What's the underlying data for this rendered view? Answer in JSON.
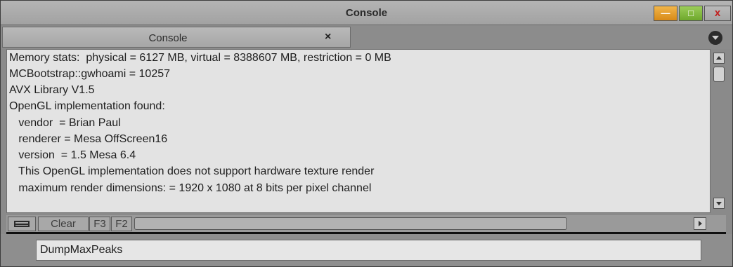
{
  "window": {
    "title": "Console",
    "minimize_glyph": "—",
    "maximize_glyph": "□",
    "close_glyph": "x"
  },
  "tab": {
    "label": "Console",
    "close_glyph": "×"
  },
  "output": {
    "lines": [
      "Memory stats:  physical = 6127 MB, virtual = 8388607 MB, restriction = 0 MB",
      "MCBootstrap::gwhoami = 10257",
      "AVX Library V1.5",
      "OpenGL implementation found:",
      "   vendor  = Brian Paul",
      "   renderer = Mesa OffScreen16",
      "   version  = 1.5 Mesa 6.4",
      "   This OpenGL implementation does not support hardware texture render",
      "   maximum render dimensions: = 1920 x 1080 at 8 bits per pixel channel"
    ]
  },
  "toolbar": {
    "clear_label": "Clear",
    "f3_label": "F3",
    "f2_label": "F2"
  },
  "command": {
    "value": "DumpMaxPeaks"
  },
  "icons": {
    "split": "split-view-icon",
    "menu": "panel-menu-icon",
    "scroll_up": "scroll-up-arrow-icon",
    "scroll_down": "scroll-down-arrow-icon",
    "scroll_right": "scroll-right-arrow-icon"
  },
  "colors": {
    "minimize": "#e3a032",
    "maximize": "#86bd44",
    "close_glyph": "#c0201f",
    "output_bg": "#e3e3e3"
  }
}
